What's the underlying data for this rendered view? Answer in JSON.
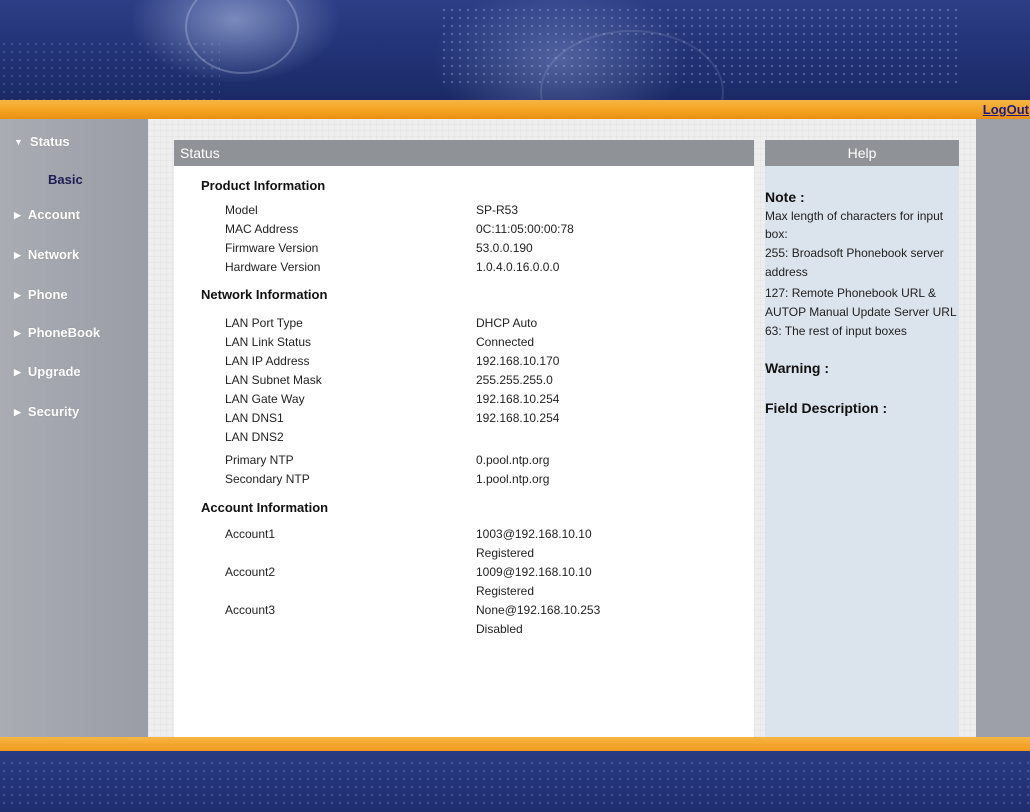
{
  "topbar": {
    "logout_label": "LogOut"
  },
  "sidebar": {
    "items": [
      {
        "label": "Status",
        "expanded": true
      },
      {
        "label": "Account"
      },
      {
        "label": "Network"
      },
      {
        "label": "Phone"
      },
      {
        "label": "PhoneBook"
      },
      {
        "label": "Upgrade"
      },
      {
        "label": "Security"
      }
    ],
    "sub_items": [
      {
        "label": "Basic"
      }
    ]
  },
  "main": {
    "header": "Status",
    "product": {
      "title": "Product Information",
      "rows": [
        {
          "label": "Model",
          "value": "SP-R53"
        },
        {
          "label": "MAC Address",
          "value": "0C:11:05:00:00:78"
        },
        {
          "label": "Firmware Version",
          "value": "53.0.0.190"
        },
        {
          "label": "Hardware Version",
          "value": "1.0.4.0.16.0.0.0"
        }
      ]
    },
    "network": {
      "title": "Network Information",
      "rows": [
        {
          "label": "LAN Port Type",
          "value": "DHCP Auto"
        },
        {
          "label": "LAN Link Status",
          "value": "Connected"
        },
        {
          "label": "LAN IP Address",
          "value": "192.168.10.170"
        },
        {
          "label": "LAN Subnet Mask",
          "value": "255.255.255.0"
        },
        {
          "label": "LAN Gate Way",
          "value": "192.168.10.254"
        },
        {
          "label": "LAN DNS1",
          "value": "192.168.10.254"
        },
        {
          "label": "LAN DNS2",
          "value": ""
        },
        {
          "label": "Primary NTP",
          "value": "0.pool.ntp.org"
        },
        {
          "label": "Secondary NTP",
          "value": "1.pool.ntp.org"
        }
      ]
    },
    "account": {
      "title": "Account Information",
      "rows": [
        {
          "label": "Account1",
          "value": "1003@192.168.10.10",
          "status": "Registered"
        },
        {
          "label": "Account2",
          "value": "1009@192.168.10.10",
          "status": "Registered"
        },
        {
          "label": "Account3",
          "value": "None@192.168.10.253",
          "status": "Disabled"
        }
      ]
    }
  },
  "help": {
    "header": "Help",
    "note_title": "Note :",
    "note_lines": [
      "Max length of characters for input",
      "box:",
      "255: Broadsoft Phonebook server",
      "address",
      "127: Remote Phonebook URL &",
      "AUTOP Manual Update Server URL",
      "63: The rest of input boxes"
    ],
    "warning_title": "Warning :",
    "field_title": "Field Description :"
  },
  "colors": {
    "orange_bar": "#f4a11f",
    "banner_blue": "#213275",
    "panel_header": "#8f9296",
    "help_bg": "#dbe3ec",
    "sidebar": "#a3a6ad",
    "link": "#1a1a8c"
  },
  "icons": {
    "expanded_arrow": "triangle-down-icon",
    "collapsed_arrow": "triangle-right-icon"
  }
}
